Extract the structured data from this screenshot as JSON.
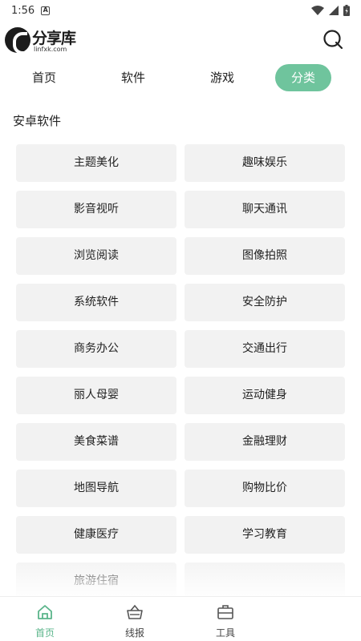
{
  "status_bar": {
    "time": "1:56",
    "notification_glyph": "A"
  },
  "header": {
    "logo_name": "分享库",
    "logo_domain": "linfxk.com",
    "search_icon": "search-icon"
  },
  "tabs": [
    {
      "label": "首页",
      "active": false
    },
    {
      "label": "软件",
      "active": false
    },
    {
      "label": "游戏",
      "active": false
    },
    {
      "label": "分类",
      "active": true
    }
  ],
  "section": {
    "title": "安卓软件"
  },
  "categories": [
    "主题美化",
    "趣味娱乐",
    "影音视听",
    "聊天通讯",
    "浏览阅读",
    "图像拍照",
    "系统软件",
    "安全防护",
    "商务办公",
    "交通出行",
    "丽人母婴",
    "运动健身",
    "美食菜谱",
    "金融理财",
    "地图导航",
    "购物比价",
    "健康医疗",
    "学习教育",
    "旅游住宿",
    ""
  ],
  "bottom_nav": [
    {
      "label": "首页",
      "icon": "home-icon",
      "active": true
    },
    {
      "label": "线报",
      "icon": "basket-icon",
      "active": false
    },
    {
      "label": "工具",
      "icon": "toolbox-icon",
      "active": false
    }
  ],
  "colors": {
    "accent": "#6fc49d",
    "tile_bg": "#f2f2f2",
    "nav_active": "#5bb58b"
  }
}
